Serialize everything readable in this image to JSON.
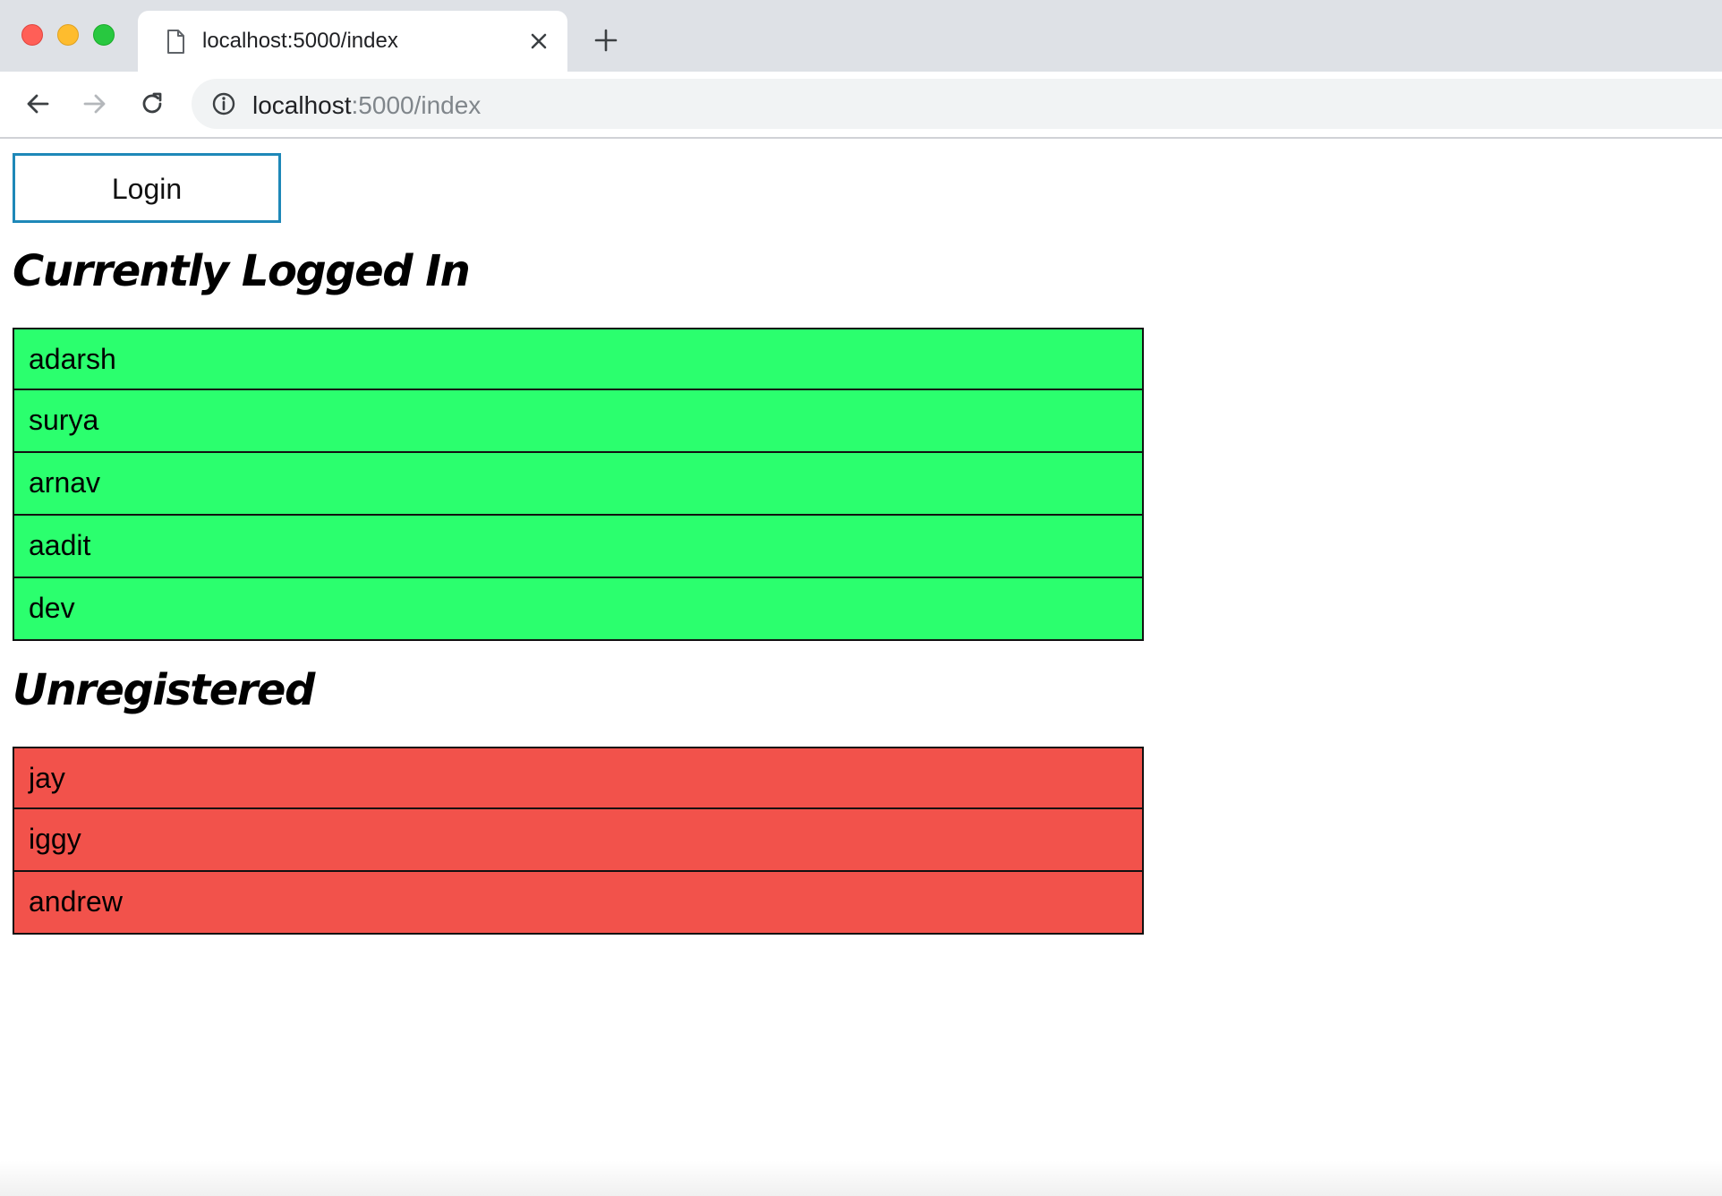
{
  "browser": {
    "tab_title": "localhost:5000/index",
    "url_host": "localhost",
    "url_rest": ":5000/index"
  },
  "page": {
    "login_label": "Login",
    "logged_in": {
      "heading": "Currently Logged In",
      "users": [
        "adarsh",
        "surya",
        "arnav",
        "aadit",
        "dev"
      ],
      "row_color": "#2bff6e"
    },
    "unregistered": {
      "heading": "Unregistered",
      "users": [
        "jay",
        "iggy",
        "andrew"
      ],
      "row_color": "#f2524b"
    }
  },
  "icons": {
    "tab": "document-icon",
    "close": "close-icon",
    "new_tab": "plus-icon",
    "back": "back-arrow-icon",
    "forward": "forward-arrow-icon",
    "reload": "reload-icon",
    "site_info": "info-icon"
  }
}
